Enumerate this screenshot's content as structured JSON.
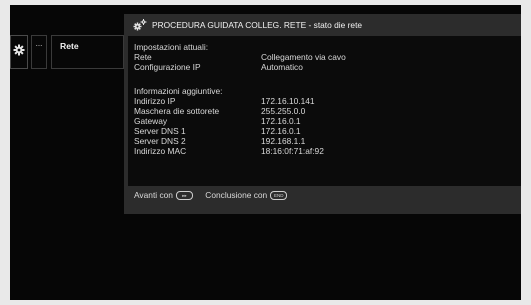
{
  "menu": {
    "gear_icon": "gear-icon",
    "more_label": "...",
    "rete_label": "Rete"
  },
  "dialog": {
    "header_icon": "network-gears-icon",
    "title": "PROCEDURA GUIDATA COLLEG. RETE - stato die rete",
    "current_heading": "Impostazioni attuali:",
    "current_rows": [
      {
        "label": "Rete",
        "value": "Collegamento via cavo"
      },
      {
        "label": "Configurazione IP",
        "value": "Automatico"
      }
    ],
    "extra_heading": "Informazioni aggiuntive:",
    "extra_rows": [
      {
        "label": "Indirizzo IP",
        "value": "172.16.10.141"
      },
      {
        "label": "Maschera die sottorete",
        "value": "255.255.0.0"
      },
      {
        "label": "Gateway",
        "value": "172.16.0.1"
      },
      {
        "label": "Server DNS 1",
        "value": "172.16.0.1"
      },
      {
        "label": "Server DNS 2",
        "value": "192.168.1.1"
      },
      {
        "label": "Indirizzo MAC",
        "value": "18:16:0f:71:af:92"
      }
    ],
    "footer": {
      "next_label": "Avanti con",
      "next_key": "▸▸",
      "done_label": "Conclusione con",
      "done_key": "END"
    }
  },
  "colors": {
    "screen_bg": "#060606",
    "dialog_bg": "#2c2c2c",
    "body_bg": "#0b0b0b",
    "text": "#d9d9d9",
    "page_bg": "#e9e9e9"
  }
}
